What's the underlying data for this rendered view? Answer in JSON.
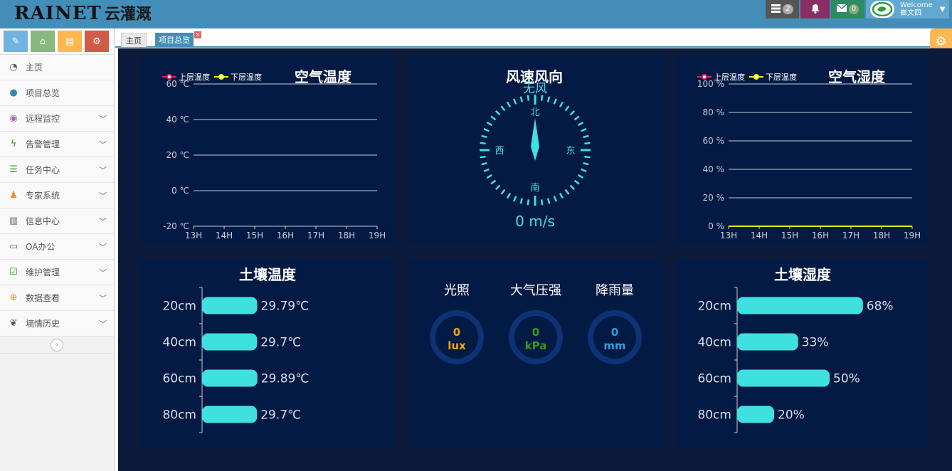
{
  "header": {
    "logo_en": "RAINET",
    "logo_cn": "云灌溉",
    "tasks_badge": "2",
    "mail_badge": "0",
    "welcome": "Welcome",
    "user": "崔文四"
  },
  "sidebar": {
    "items": [
      {
        "label": "主页",
        "icon": "dashboard-icon",
        "expandable": false
      },
      {
        "label": "项目总览",
        "icon": "globe-icon",
        "expandable": false
      },
      {
        "label": "远程监控",
        "icon": "eye-icon",
        "expandable": true
      },
      {
        "label": "告警管理",
        "icon": "bolt-icon",
        "expandable": true
      },
      {
        "label": "任务中心",
        "icon": "tasks-icon",
        "expandable": true
      },
      {
        "label": "专家系统",
        "icon": "users-icon",
        "expandable": true
      },
      {
        "label": "信息中心",
        "icon": "barcode-icon",
        "expandable": true
      },
      {
        "label": "OA办公",
        "icon": "laptop-icon",
        "expandable": true
      },
      {
        "label": "维护管理",
        "icon": "check-square-icon",
        "expandable": true
      },
      {
        "label": "数据查看",
        "icon": "download-icon",
        "expandable": true
      },
      {
        "label": "墒情历史",
        "icon": "leaf-icon",
        "expandable": true
      }
    ]
  },
  "tabs": [
    {
      "label": "主页",
      "active": false
    },
    {
      "label": "项目总览",
      "active": true
    }
  ],
  "tab_close": "×",
  "panels": {
    "air_temp": {
      "title": "空气温度",
      "legend": [
        "上层温度",
        "下层温度"
      ],
      "legend_colors": [
        "#e0245e",
        "#f5f500"
      ],
      "y_ticks": [
        "60 ℃",
        "40 ℃",
        "20 ℃",
        "0 ℃",
        "-20 ℃"
      ],
      "x_ticks": [
        "13H",
        "14H",
        "15H",
        "16H",
        "17H",
        "18H",
        "19H"
      ]
    },
    "wind": {
      "title": "风速风向",
      "direction": "无风",
      "north": "北",
      "south": "南",
      "east": "东",
      "west": "西",
      "speed": "0 m/s"
    },
    "air_humidity": {
      "title": "空气湿度",
      "legend": [
        "上层温度",
        "下层温度"
      ],
      "legend_colors": [
        "#e0245e",
        "#f5f500"
      ],
      "y_ticks": [
        "100 %",
        "80 %",
        "60 %",
        "40 %",
        "20 %",
        "0 %"
      ],
      "x_ticks": [
        "13H",
        "14H",
        "15H",
        "16H",
        "17H",
        "18H",
        "19H"
      ]
    },
    "soil_temp": {
      "title": "土壤温度",
      "rows": [
        {
          "depth": "20cm",
          "label": "29.79℃"
        },
        {
          "depth": "40cm",
          "label": "29.7℃"
        },
        {
          "depth": "60cm",
          "label": "29.89℃"
        },
        {
          "depth": "80cm",
          "label": "29.7℃"
        }
      ]
    },
    "env": {
      "gauges": [
        {
          "title": "光照",
          "value": "0",
          "unit": "lux",
          "color": "#f0a30a"
        },
        {
          "title": "大气压强",
          "value": "0",
          "unit": "kPa",
          "color": "#3a9a1a"
        },
        {
          "title": "降雨量",
          "value": "0",
          "unit": "mm",
          "color": "#2ea0dd"
        }
      ]
    },
    "soil_humidity": {
      "title": "土壤湿度",
      "rows": [
        {
          "depth": "20cm",
          "label": "68%"
        },
        {
          "depth": "40cm",
          "label": "33%"
        },
        {
          "depth": "60cm",
          "label": "50%"
        },
        {
          "depth": "80cm",
          "label": "20%"
        }
      ]
    }
  },
  "chart_data": [
    {
      "type": "line",
      "title": "空气温度",
      "x": [
        "13H",
        "14H",
        "15H",
        "16H",
        "17H",
        "18H",
        "19H"
      ],
      "ylim": [
        -20,
        60
      ],
      "series": [
        {
          "name": "上层温度",
          "values": []
        },
        {
          "name": "下层温度",
          "values": []
        }
      ],
      "grid": true,
      "legend": "top-left"
    },
    {
      "type": "line",
      "title": "空气湿度",
      "x": [
        "13H",
        "14H",
        "15H",
        "16H",
        "17H",
        "18H",
        "19H"
      ],
      "ylim": [
        0,
        100
      ],
      "series": [
        {
          "name": "上层温度",
          "values": []
        },
        {
          "name": "下层温度",
          "values": [
            0,
            0,
            0,
            0,
            0,
            0,
            0
          ]
        }
      ],
      "grid": true,
      "legend": "top-left"
    },
    {
      "type": "bar",
      "title": "土壤温度",
      "categories": [
        "20cm",
        "40cm",
        "60cm",
        "80cm"
      ],
      "values": [
        29.79,
        29.7,
        29.89,
        29.7
      ],
      "xlim": [
        0,
        100
      ]
    },
    {
      "type": "bar",
      "title": "土壤湿度",
      "categories": [
        "20cm",
        "40cm",
        "60cm",
        "80cm"
      ],
      "values": [
        68,
        33,
        50,
        20
      ],
      "xlim": [
        0,
        100
      ]
    }
  ],
  "colors": {
    "header": "#438eb9",
    "panel_bg": "#031a44",
    "page_bg": "#0b1a3a",
    "accent": "#3ee0e0"
  }
}
